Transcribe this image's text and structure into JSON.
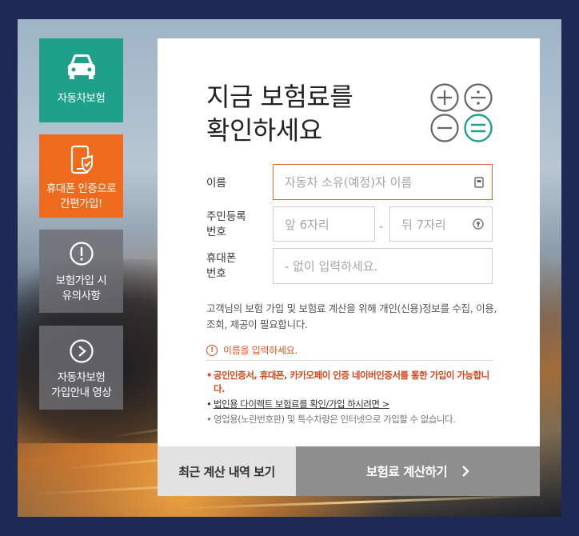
{
  "side_menu": {
    "car_insurance": "자동차보험",
    "phone_auth_line1": "휴대폰 인증으로",
    "phone_auth_line2": "간편가입!",
    "notice_line1": "보험가입 시",
    "notice_line2": "유의사항",
    "video_line1": "자동차보험",
    "video_line2": "가입안내 영상"
  },
  "form": {
    "title_line1": "지금 보험료를",
    "title_line2": "확인하세요",
    "name_label": "이름",
    "name_placeholder": "자동차 소유(예정)자 이름",
    "rrn_label_line1": "주민등록",
    "rrn_label_line2": "번호",
    "rrn_front_placeholder": "앞 6자리",
    "rrn_dash": "-",
    "rrn_back_placeholder": "뒤 7자리",
    "phone_label_line1": "휴대폰",
    "phone_label_line2": "번호",
    "phone_placeholder": "- 없이 입력하세요.",
    "consent_notice": "고객님의 보험 가입 및 보험료 계산을 위해 개인(신용)정보를 수집, 이용, 조회, 제공이 필요합니다.",
    "error_message": "이름을 입력하세요.",
    "bullet_1": "공인인증서, 휴대폰, 카카오페이 인증 네이버인증서를 통한 가입이 가능합니다.",
    "bullet_2": "법인용 다이렉트 보험료를 확인/가입 하시려면 >",
    "bullet_3": "영업용(노란번호판) 및 특수차량은 인터넷으로 가입할 수 없습니다."
  },
  "actions": {
    "recent_history": "최근 계산 내역 보기",
    "calculate": "보험료 계산하기"
  },
  "colors": {
    "green": "#1ea08a",
    "orange": "#ee6a1c",
    "gray": "#6e6e73",
    "frame": "#1e2a55",
    "error": "#e0561f"
  }
}
